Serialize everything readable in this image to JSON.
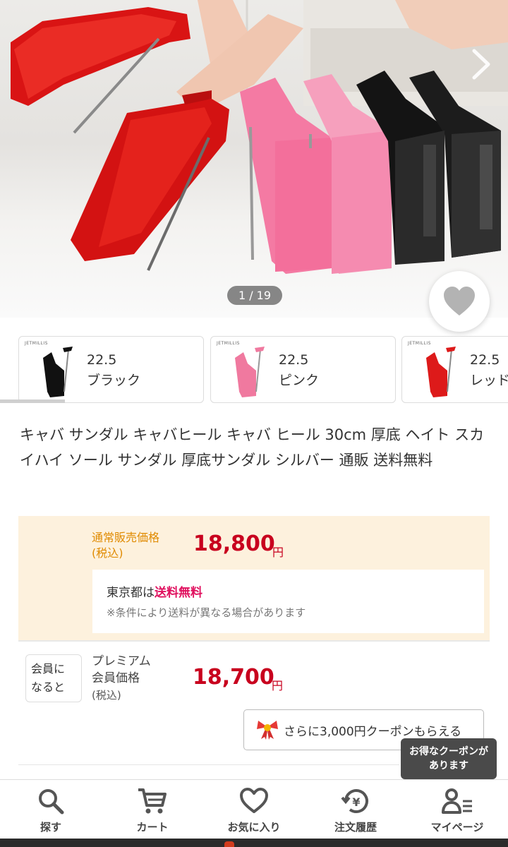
{
  "gallery": {
    "counter": "1 / 19"
  },
  "variations": [
    {
      "size": "22.5",
      "color": "ブラック",
      "swatch": "#111111",
      "brand": "JETMILLIS"
    },
    {
      "size": "22.5",
      "color": "ピンク",
      "swatch": "#f0799f",
      "brand": "JETMILLIS"
    },
    {
      "size": "22.5",
      "color": "レッド",
      "swatch": "#dd1a1a",
      "brand": "JETMILLIS"
    }
  ],
  "product": {
    "title": "キャバ サンダル キャバヒール キャバ ヒール 30cm 厚底 ヘイト スカイハイ ソール サンダル 厚底サンダル シルバー 通販 送料無料"
  },
  "price": {
    "label_line1": "通常販売価格",
    "label_line2": "(税込)",
    "value": "18,800",
    "unit": "円"
  },
  "shipping": {
    "region": "東京都は",
    "free_label": "送料無料",
    "note": "※条件により送料が異なる場合があります"
  },
  "member": {
    "badge_line1": "会員に",
    "badge_line2": "なると",
    "label_line1": "プレミアム",
    "label_line2": "会員価格",
    "label_line3": "(税込)",
    "value": "18,700",
    "unit": "円"
  },
  "coupon": {
    "button_label": "さらに3,000円クーポンもらえる",
    "tooltip_line1": "お得なクーポンが",
    "tooltip_line2": "あります"
  },
  "nav": [
    {
      "label": "探す",
      "icon": "search-icon"
    },
    {
      "label": "カート",
      "icon": "cart-icon"
    },
    {
      "label": "お気に入り",
      "icon": "heart-icon"
    },
    {
      "label": "注文履歴",
      "icon": "order-history-icon"
    },
    {
      "label": "マイページ",
      "icon": "mypage-icon"
    }
  ],
  "colors": {
    "price_red": "#c8001e",
    "label_orange": "#e08a00",
    "free_shipping_pink": "#e0115f",
    "price_box_bg": "#fdf1dd"
  }
}
